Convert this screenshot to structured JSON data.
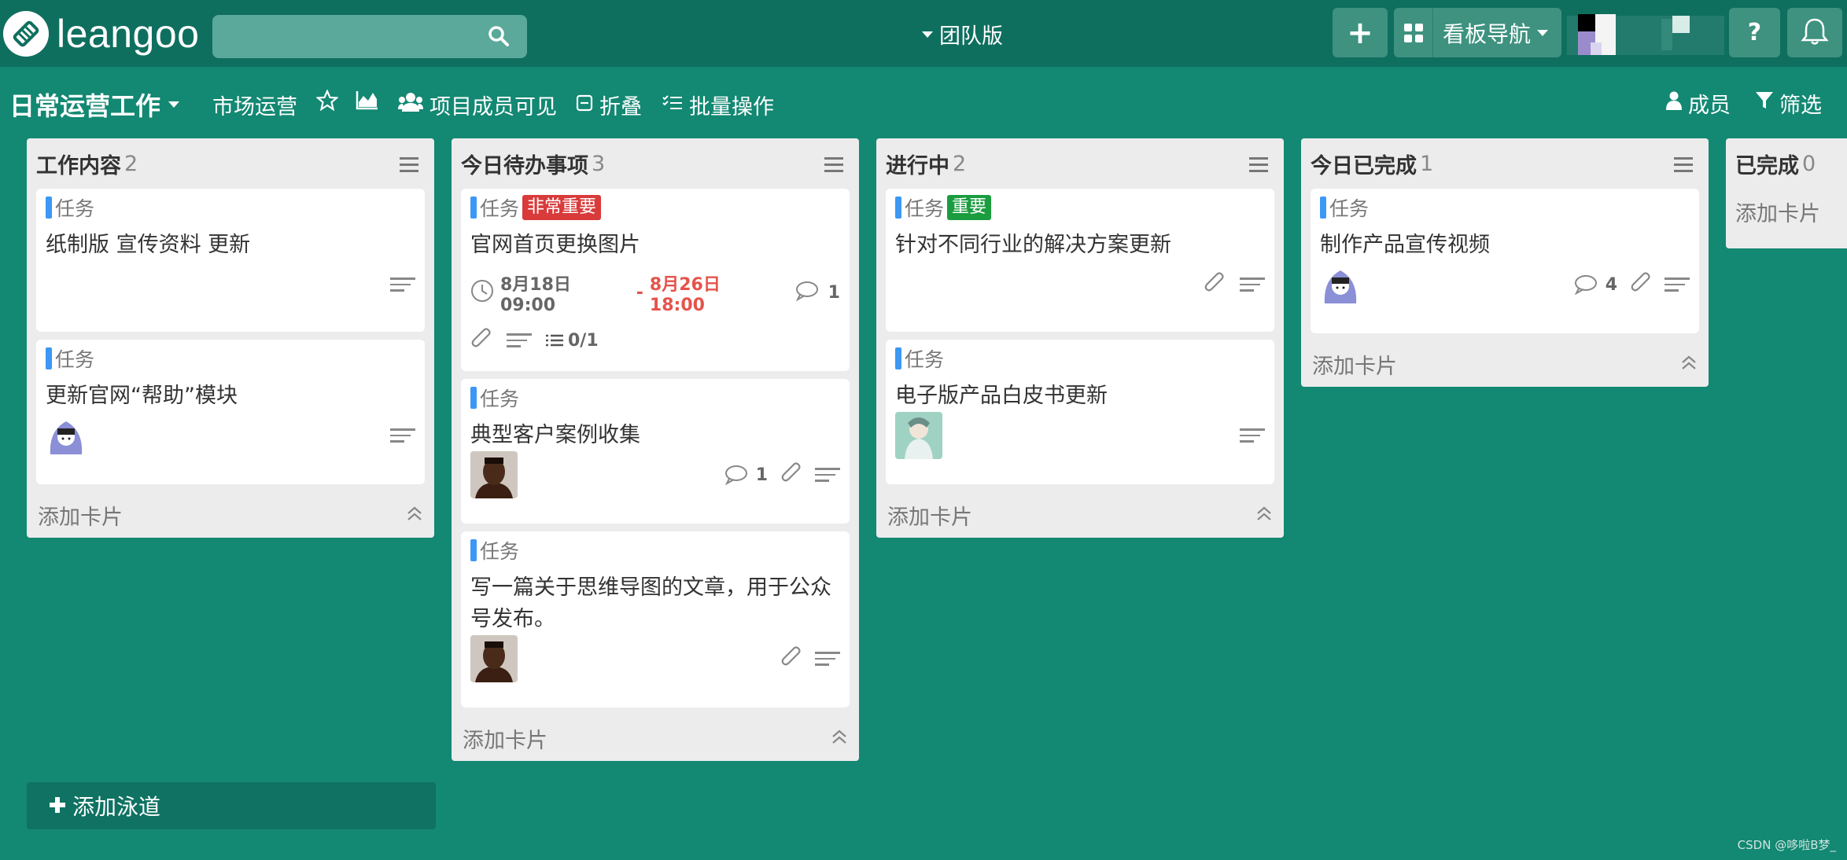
{
  "app": {
    "logo_text": "leangoo",
    "search": {
      "placeholder": ""
    },
    "team_label": "团队版",
    "board_nav_label": "看板导航",
    "help_label": "?",
    "add_label": "+"
  },
  "board": {
    "title": "日常运营工作",
    "project": "市场运营",
    "visibility": "项目成员可见",
    "collapse": "折叠",
    "batch": "批量操作",
    "members": "成员",
    "filter": "筛选"
  },
  "lists": [
    {
      "title": "工作内容",
      "count": "2",
      "cards": [
        {
          "type": "任务",
          "title": "纸制版 宣传资料 更新"
        },
        {
          "type": "任务",
          "title": "更新官网“帮助”模块"
        }
      ],
      "add_card": "添加卡片"
    },
    {
      "title": "今日待办事项",
      "count": "3",
      "cards": [
        {
          "type": "任务",
          "tag": "非常重要",
          "title": "官网首页更换图片",
          "start": "8月18日 09:00",
          "sep": "-",
          "due": "8月26日 18:00",
          "comments": "1",
          "checklist": "0/1"
        },
        {
          "type": "任务",
          "title": "典型客户案例收集",
          "comments": "1"
        },
        {
          "type": "任务",
          "title": "写一篇关于思维导图的文章，用于公众号发布。"
        }
      ],
      "add_card": "添加卡片"
    },
    {
      "title": "进行中",
      "count": "2",
      "cards": [
        {
          "type": "任务",
          "tag": "重要",
          "title": "针对不同行业的解决方案更新"
        },
        {
          "type": "任务",
          "title": "电子版产品白皮书更新"
        }
      ],
      "add_card": "添加卡片"
    },
    {
      "title": "今日已完成",
      "count": "1",
      "cards": [
        {
          "type": "任务",
          "title": "制作产品宣传视频",
          "comments": "4"
        }
      ],
      "add_card": "添加卡片"
    },
    {
      "title": "已完成",
      "count": "0",
      "cards": [],
      "add_card": "添加卡片"
    }
  ],
  "add_lane": "添加泳道",
  "watermark": "CSDN @哆啦B梦_",
  "colors": {
    "background": "#138873",
    "topbar": "#0f6f5f",
    "tag_red": "#d93a3a",
    "tag_green": "#1a9c3f",
    "type_bar": "#3c97f5",
    "due": "#e5534b"
  }
}
